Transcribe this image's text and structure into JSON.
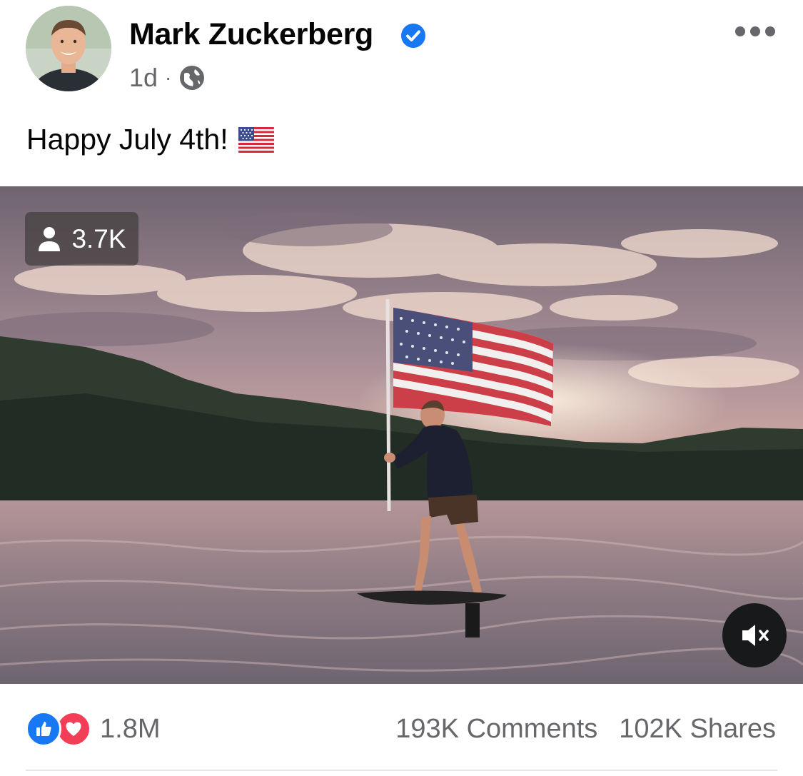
{
  "post": {
    "author": "Mark Zuckerberg",
    "verified": true,
    "time": "1d",
    "separator": "·",
    "privacy_icon": "globe-icon",
    "more_icon": "more-options-icon",
    "text": "Happy July 4th!",
    "emoji": "us-flag-emoji"
  },
  "video": {
    "viewers": "3.7K",
    "viewer_icon": "person-icon",
    "muted": true,
    "mute_icon": "speaker-muted-icon"
  },
  "engagement": {
    "reaction_icons": [
      "like-icon",
      "love-icon"
    ],
    "reactions_count": "1.8M",
    "comments": "193K Comments",
    "shares": "102K Shares"
  },
  "colors": {
    "accent": "#1877f2",
    "love": "#f33e58",
    "secondary_text": "#65676b"
  }
}
